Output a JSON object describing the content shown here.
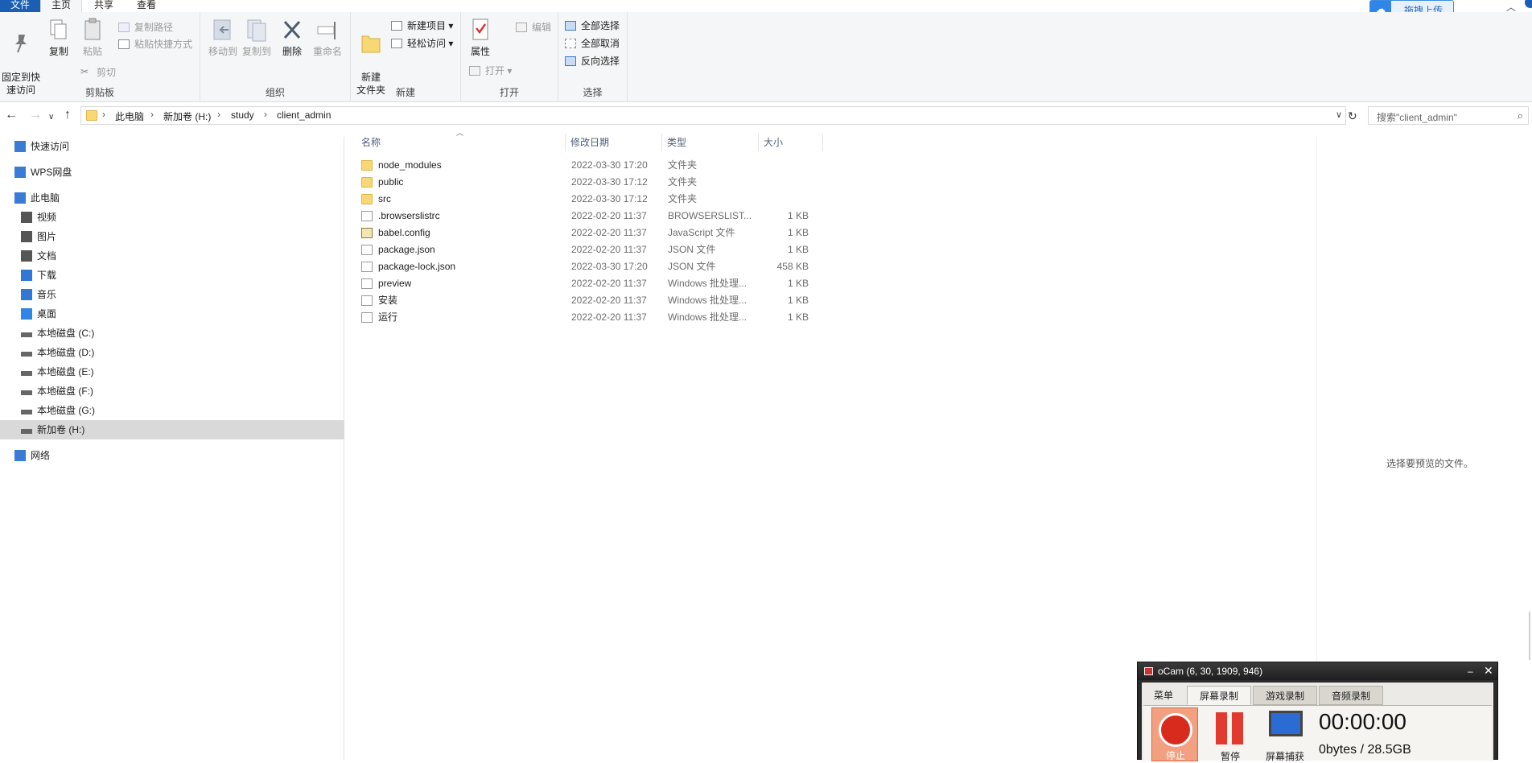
{
  "ribbon_tabs": [
    "文件",
    "主页",
    "共享",
    "查看"
  ],
  "upload_button": "拖拽上传",
  "ribbon": {
    "clipboard": {
      "label": "剪贴板",
      "pin": "固定到快\n速访问",
      "copy": "复制",
      "paste": "粘贴",
      "copy_path": "复制路径",
      "paste_shortcut": "粘贴快捷方式",
      "cut": "剪切"
    },
    "organize": {
      "label": "组织",
      "move_to": "移动到",
      "copy_to": "复制到",
      "delete": "删除",
      "rename": "重命名"
    },
    "new": {
      "label": "新建",
      "new_folder": "新建\n文件夹",
      "new_item": "新建项目",
      "easy_access": "轻松访问"
    },
    "open": {
      "label": "打开",
      "properties": "属性",
      "open": "打开",
      "edit": "编辑"
    },
    "select": {
      "label": "选择",
      "select_all": "全部选择",
      "select_none": "全部取消",
      "invert": "反向选择"
    }
  },
  "address": {
    "crumbs": [
      "此电脑",
      "新加卷 (H:)",
      "study",
      "client_admin"
    ]
  },
  "search": {
    "placeholder": "搜索\"client_admin\""
  },
  "nav": [
    {
      "label": "快速访问",
      "icon": "star-icon",
      "indent": 0
    },
    {
      "label": "WPS网盘",
      "icon": "cloud-icon",
      "indent": 0
    },
    {
      "label": "此电脑",
      "icon": "computer-icon",
      "indent": 0
    },
    {
      "label": "视频",
      "icon": "video-icon",
      "indent": 1
    },
    {
      "label": "图片",
      "icon": "picture-icon",
      "indent": 1
    },
    {
      "label": "文档",
      "icon": "document-icon",
      "indent": 1
    },
    {
      "label": "下载",
      "icon": "download-icon",
      "indent": 1
    },
    {
      "label": "音乐",
      "icon": "music-icon",
      "indent": 1
    },
    {
      "label": "桌面",
      "icon": "desktop-icon",
      "indent": 1
    },
    {
      "label": "本地磁盘 (C:)",
      "icon": "drive-icon",
      "indent": 1
    },
    {
      "label": "本地磁盘 (D:)",
      "icon": "drive-icon",
      "indent": 1
    },
    {
      "label": "本地磁盘 (E:)",
      "icon": "drive-icon",
      "indent": 1
    },
    {
      "label": "本地磁盘 (F:)",
      "icon": "drive-icon",
      "indent": 1
    },
    {
      "label": "本地磁盘 (G:)",
      "icon": "drive-icon",
      "indent": 1
    },
    {
      "label": "新加卷 (H:)",
      "icon": "drive-icon",
      "indent": 1,
      "selected": true
    },
    {
      "label": "网络",
      "icon": "network-icon",
      "indent": 0
    }
  ],
  "columns": {
    "name": "名称",
    "date": "修改日期",
    "type": "类型",
    "size": "大小"
  },
  "files": [
    {
      "name": "node_modules",
      "date": "2022-03-30 17:20",
      "type": "文件夹",
      "size": "",
      "icon": "folder-icon"
    },
    {
      "name": "public",
      "date": "2022-03-30 17:12",
      "type": "文件夹",
      "size": "",
      "icon": "folder-icon"
    },
    {
      "name": "src",
      "date": "2022-03-30 17:12",
      "type": "文件夹",
      "size": "",
      "icon": "folder-icon"
    },
    {
      "name": ".browserslistrc",
      "date": "2022-02-20 11:37",
      "type": "BROWSERSLIST...",
      "size": "1 KB",
      "icon": "file-icon"
    },
    {
      "name": "babel.config",
      "date": "2022-02-20 11:37",
      "type": "JavaScript 文件",
      "size": "1 KB",
      "icon": "js-file-icon"
    },
    {
      "name": "package.json",
      "date": "2022-02-20 11:37",
      "type": "JSON 文件",
      "size": "1 KB",
      "icon": "file-icon"
    },
    {
      "name": "package-lock.json",
      "date": "2022-03-30 17:20",
      "type": "JSON 文件",
      "size": "458 KB",
      "icon": "file-icon"
    },
    {
      "name": "preview",
      "date": "2022-02-20 11:37",
      "type": "Windows 批处理...",
      "size": "1 KB",
      "icon": "batch-file-icon"
    },
    {
      "name": "安装",
      "date": "2022-02-20 11:37",
      "type": "Windows 批处理...",
      "size": "1 KB",
      "icon": "batch-file-icon"
    },
    {
      "name": "运行",
      "date": "2022-02-20 11:37",
      "type": "Windows 批处理...",
      "size": "1 KB",
      "icon": "batch-file-icon"
    }
  ],
  "preview_text": "选择要预览的文件。",
  "ocam": {
    "title": "oCam (6, 30, 1909, 946)",
    "tabs": [
      "菜单",
      "屏幕录制",
      "游戏录制",
      "音频录制"
    ],
    "stop": "停止",
    "pause": "暂停",
    "capture": "屏幕捕获",
    "timer": "00:00:00",
    "storage": "0bytes / 28.5GB"
  },
  "colors": {
    "accent": "#1a5fb4",
    "folder": "#f8d775",
    "selected": "#d9d9d9"
  }
}
